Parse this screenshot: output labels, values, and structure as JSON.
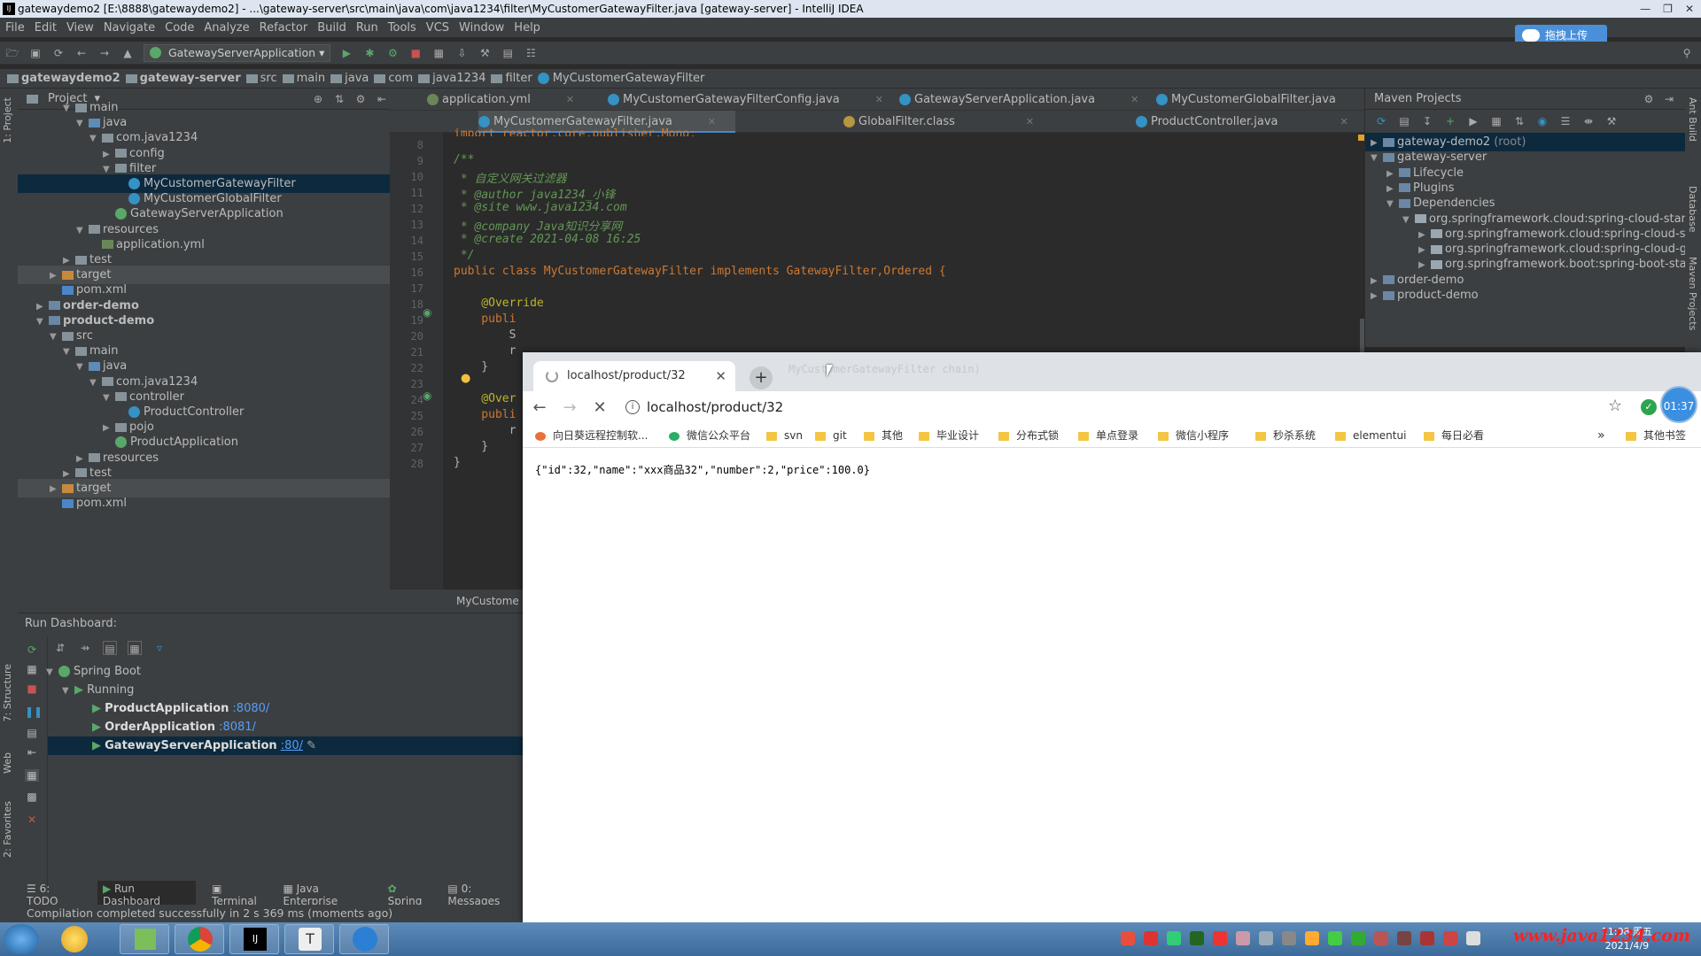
{
  "window": {
    "title": "gatewaydemo2 [E:\\8888\\gatewaydemo2] - ...\\gateway-server\\src\\main\\java\\com\\java1234\\filter\\MyCustomerGatewayFilter.java [gateway-server] - IntelliJ IDEA"
  },
  "menu": [
    "File",
    "Edit",
    "View",
    "Navigate",
    "Code",
    "Analyze",
    "Refactor",
    "Build",
    "Run",
    "Tools",
    "VCS",
    "Window",
    "Help"
  ],
  "upload_button": "拖拽上传",
  "run_config": "GatewayServerApplication",
  "breadcrumb": [
    "gatewaydemo2",
    "gateway-server",
    "src",
    "main",
    "java",
    "com",
    "java1234",
    "filter",
    "MyCustomerGatewayFilter"
  ],
  "project": {
    "title": "Project",
    "tree": [
      {
        "label": "main",
        "depth": 3,
        "open": true,
        "icon": "folder"
      },
      {
        "label": "java",
        "depth": 4,
        "open": true,
        "icon": "folder-blue"
      },
      {
        "label": "com.java1234",
        "depth": 5,
        "open": true,
        "icon": "package"
      },
      {
        "label": "config",
        "depth": 6,
        "open": false,
        "icon": "package"
      },
      {
        "label": "filter",
        "depth": 6,
        "open": true,
        "icon": "package"
      },
      {
        "label": "MyCustomerGatewayFilter",
        "depth": 7,
        "icon": "class",
        "selected": true
      },
      {
        "label": "MyCustomerGlobalFilter",
        "depth": 7,
        "icon": "class"
      },
      {
        "label": "GatewayServerApplication",
        "depth": 6,
        "icon": "spring-class"
      },
      {
        "label": "resources",
        "depth": 4,
        "open": true,
        "icon": "folder"
      },
      {
        "label": "application.yml",
        "depth": 5,
        "icon": "yml"
      },
      {
        "label": "test",
        "depth": 3,
        "open": false,
        "icon": "folder"
      },
      {
        "label": "target",
        "depth": 2,
        "open": false,
        "icon": "folder-orange",
        "dim": true
      },
      {
        "label": "pom.xml",
        "depth": 2,
        "icon": "maven"
      },
      {
        "label": "order-demo",
        "depth": 1,
        "open": false,
        "icon": "module",
        "bold": true
      },
      {
        "label": "product-demo",
        "depth": 1,
        "open": true,
        "icon": "module",
        "bold": true
      },
      {
        "label": "src",
        "depth": 2,
        "open": true,
        "icon": "folder"
      },
      {
        "label": "main",
        "depth": 3,
        "open": true,
        "icon": "folder"
      },
      {
        "label": "java",
        "depth": 4,
        "open": true,
        "icon": "folder-blue"
      },
      {
        "label": "com.java1234",
        "depth": 5,
        "open": true,
        "icon": "package"
      },
      {
        "label": "controller",
        "depth": 6,
        "open": true,
        "icon": "package"
      },
      {
        "label": "ProductController",
        "depth": 7,
        "icon": "class"
      },
      {
        "label": "pojo",
        "depth": 6,
        "open": false,
        "icon": "package"
      },
      {
        "label": "ProductApplication",
        "depth": 6,
        "icon": "spring-class"
      },
      {
        "label": "resources",
        "depth": 4,
        "open": false,
        "icon": "folder"
      },
      {
        "label": "test",
        "depth": 3,
        "open": false,
        "icon": "folder"
      },
      {
        "label": "target",
        "depth": 2,
        "open": false,
        "icon": "folder-orange",
        "dim": true
      },
      {
        "label": "pom.xml",
        "depth": 2,
        "icon": "maven"
      }
    ]
  },
  "editor": {
    "tabs_row1": [
      "application.yml",
      "MyCustomerGatewayFilterConfig.java",
      "GatewayServerApplication.java",
      "MyCustomerGlobalFilter.java"
    ],
    "tabs_row2": [
      "MyCustomerGatewayFilter.java",
      "GlobalFilter.class",
      "ProductController.java"
    ],
    "active_tab": "MyCustomerGatewayFilter.java",
    "lines": [
      {
        "n": "8",
        "t": ""
      },
      {
        "n": "9",
        "t": "/**"
      },
      {
        "n": "10",
        "t": " * 自定义网关过滤器"
      },
      {
        "n": "11",
        "t": " * @author java1234_小锋"
      },
      {
        "n": "12",
        "t": " * @site www.java1234.com"
      },
      {
        "n": "13",
        "t": " * @company Java知识分享网"
      },
      {
        "n": "14",
        "t": " * @create 2021-04-08 16:25"
      },
      {
        "n": "15",
        "t": " */"
      },
      {
        "n": "16",
        "t": "public class MyCustomerGatewayFilter implements GatewayFilter,Ordered {"
      },
      {
        "n": "17",
        "t": ""
      },
      {
        "n": "18",
        "t": "    @Override"
      },
      {
        "n": "19",
        "t": "    publi"
      },
      {
        "n": "20",
        "t": "        S"
      },
      {
        "n": "21",
        "t": "        r"
      },
      {
        "n": "22",
        "t": "    }"
      },
      {
        "n": "23",
        "t": ""
      },
      {
        "n": "24",
        "t": "    @Over"
      },
      {
        "n": "25",
        "t": "    publi"
      },
      {
        "n": "26",
        "t": "        r"
      },
      {
        "n": "27",
        "t": "    }"
      },
      {
        "n": "28",
        "t": "}"
      }
    ],
    "top_line": "import reactor.core.publisher.Mono;",
    "footer_crumb": "MyCustome"
  },
  "maven": {
    "title": "Maven Projects",
    "tree": [
      {
        "label": "gateway-demo2",
        "suffix": "(root)",
        "depth": 0,
        "open": false,
        "selected": true
      },
      {
        "label": "gateway-server",
        "depth": 0,
        "open": true
      },
      {
        "label": "Lifecycle",
        "depth": 1,
        "open": false
      },
      {
        "label": "Plugins",
        "depth": 1,
        "open": false
      },
      {
        "label": "Dependencies",
        "depth": 1,
        "open": true
      },
      {
        "label": "org.springframework.cloud:spring-cloud-starter",
        "depth": 2,
        "open": true
      },
      {
        "label": "org.springframework.cloud:spring-cloud-sta",
        "depth": 3,
        "open": false
      },
      {
        "label": "org.springframework.cloud:spring-cloud-gat",
        "depth": 3,
        "open": false
      },
      {
        "label": "org.springframework.boot:spring-boot-start",
        "depth": 3,
        "open": false
      },
      {
        "label": "order-demo",
        "depth": 0,
        "open": false
      },
      {
        "label": "product-demo",
        "depth": 0,
        "open": false
      }
    ]
  },
  "run_dashboard": {
    "title": "Run Dashboard:",
    "root": "Spring Boot",
    "group": "Running",
    "apps": [
      {
        "name": "ProductApplication",
        "port": ":8080/"
      },
      {
        "name": "OrderApplication",
        "port": ":8081/"
      },
      {
        "name": "GatewayServerApplication",
        "port": ":80/",
        "selected": true
      }
    ]
  },
  "bottom_tabs": [
    "6: TODO",
    "Run Dashboard",
    "Terminal",
    "Java Enterprise",
    "Spring",
    "0: Messages"
  ],
  "status": "Compilation completed successfully in 2 s 369 ms (moments ago)",
  "side_labels": {
    "left": [
      "1: Project",
      "7: Structure",
      "Web",
      "2: Favorites"
    ],
    "right": [
      "Ant Build",
      "Database",
      "Maven Projects"
    ]
  },
  "browser": {
    "tab_title": "localhost/product/32",
    "url": "localhost/product/32",
    "time_badge": "01:37",
    "bookmarks": [
      "向日葵远程控制软...",
      "微信公众平台",
      "svn",
      "git",
      "其他",
      "毕业设计",
      "分布式锁",
      "单点登录",
      "微信小程序",
      "秒杀系统",
      "elementui",
      "每日必看"
    ],
    "more": "»",
    "other_bookmarks": "其他书签",
    "body": "{\"id\":32,\"name\":\"xxx商品32\",\"number\":2,\"price\":100.0}",
    "ghost_tab": "MyCustomerGatewayFilter chain)"
  },
  "taskbar": {
    "date": "2021/4/9",
    "time": "11:08 周五",
    "watermark": "www.java1234.com"
  }
}
